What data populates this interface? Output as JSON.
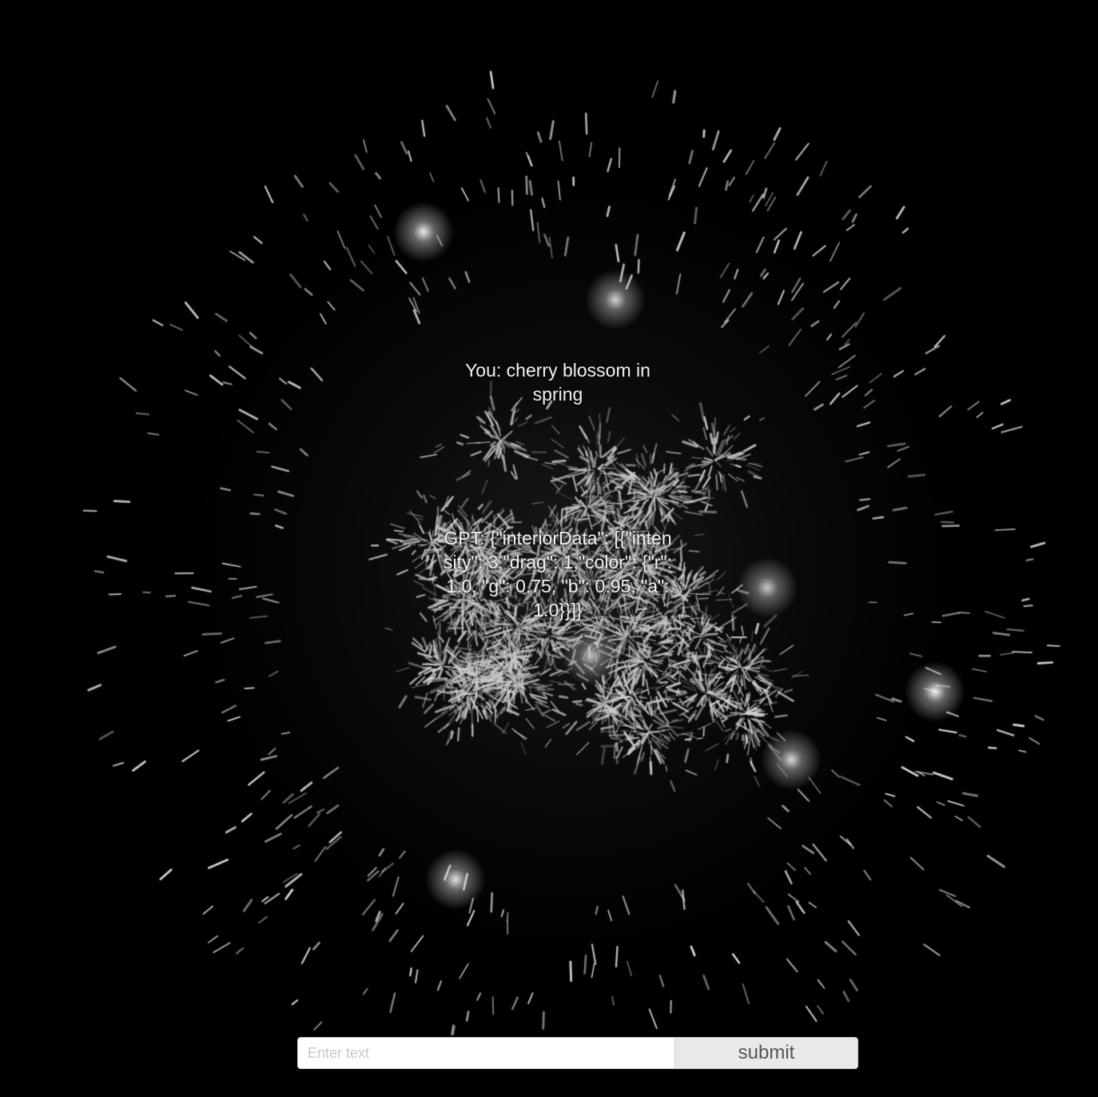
{
  "scene": {
    "background_color": "#000000",
    "particle_color": "#ffffff",
    "description_kind": "firework-particle-burst"
  },
  "chat": {
    "user_message": "You: cherry blossom in spring",
    "gpt_message": "GPT: {\"interiorData\": [{\"intensity\": 3,\"drag\": 1,\"color\": {\"r\": 1.0, \"g\": 0.75, \"b\": 0.95, \"a\": 1.0}}]}"
  },
  "input": {
    "placeholder": "Enter text",
    "value": ""
  },
  "submit": {
    "label": "submit"
  }
}
